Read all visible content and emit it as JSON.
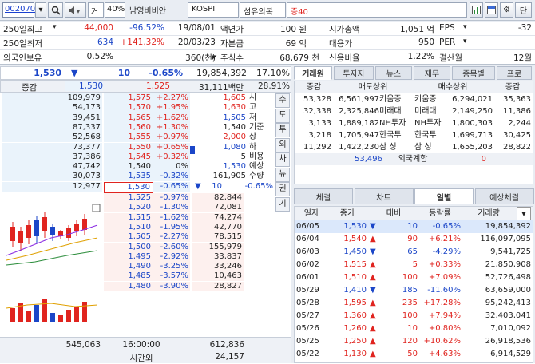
{
  "toolbar": {
    "code": "002070",
    "mode": "거",
    "ratio": "40%",
    "name": "남영비비안",
    "market": "KOSPI",
    "sector": "섬유의복",
    "margin": "증40",
    "btn_t": "단"
  },
  "info": {
    "r1": {
      "l1": "250일최고",
      "v1": "44,000",
      "v2": "-96.52%",
      "v3": "19/08/01",
      "l2": "액면가",
      "v4": "100 원",
      "l3": "시가총액",
      "v5": "1,051 억",
      "l4": "EPS",
      "v6": "-32"
    },
    "r2": {
      "l1": "250일최저",
      "v1": "634",
      "v2": "+141.32%",
      "v3": "20/03/23",
      "l2": "자본금",
      "v4": "69 억",
      "l3": "대용가",
      "v5": "950",
      "l4": "PER",
      "v6": ""
    },
    "r3": {
      "l1": "외국인보유",
      "v1": "0.52%",
      "v3": "360(천)",
      "l2": "주식수",
      "v4": "68,679 천",
      "l3": "신용비율",
      "v5": "1.22%",
      "l4": "결산월",
      "v6": "12월"
    }
  },
  "quote": {
    "price": "1,530",
    "arrow": "▼",
    "diff": "10",
    "rate": "-0.65%",
    "volume": "19,854,392",
    "turnover": "17.10%"
  },
  "quote2": {
    "label": "증감",
    "v1": "1,530",
    "v2": "1,525",
    "amount": "31,111백만",
    "pct": "28.91%"
  },
  "asks": [
    {
      "q": "109,979",
      "p": "1,575",
      "r": "+2.27%"
    },
    {
      "q": "54,173",
      "p": "1,570",
      "r": "+1.95%"
    },
    {
      "q": "39,451",
      "p": "1,565",
      "r": "+1.62%"
    },
    {
      "q": "87,337",
      "p": "1,560",
      "r": "+1.30%"
    },
    {
      "q": "52,568",
      "p": "1,555",
      "r": "+0.97%"
    },
    {
      "q": "73,377",
      "p": "1,550",
      "r": "+0.65%"
    },
    {
      "q": "37,386",
      "p": "1,545",
      "r": "+0.32%"
    },
    {
      "q": "47,742",
      "p": "1,540",
      "r": "0%"
    },
    {
      "q": "30,073",
      "p": "1,535",
      "r": "-0.32%"
    },
    {
      "q": "12,977",
      "p": "1,530",
      "r": "-0.65%"
    }
  ],
  "bids": [
    {
      "p": "1,525",
      "r": "-0.97%",
      "q": "82,844"
    },
    {
      "p": "1,520",
      "r": "-1.30%",
      "q": "72,081"
    },
    {
      "p": "1,515",
      "r": "-1.62%",
      "q": "74,274"
    },
    {
      "p": "1,510",
      "r": "-1.95%",
      "q": "42,770"
    },
    {
      "p": "1,505",
      "r": "-2.27%",
      "q": "78,515"
    },
    {
      "p": "1,500",
      "r": "-2.60%",
      "q": "155,979"
    },
    {
      "p": "1,495",
      "r": "-2.92%",
      "q": "33,837"
    },
    {
      "p": "1,490",
      "r": "-3.25%",
      "q": "33,246"
    },
    {
      "p": "1,485",
      "r": "-3.57%",
      "q": "10,463"
    },
    {
      "p": "1,480",
      "r": "-3.90%",
      "q": "28,827"
    }
  ],
  "summary": [
    {
      "v": "1,605",
      "l": "시"
    },
    {
      "v": "1,630",
      "l": "고"
    },
    {
      "v": "1,505",
      "l": "저"
    },
    {
      "v": "1,540",
      "l": "기준"
    },
    {
      "v": "2,000",
      "l": "상"
    },
    {
      "v": "1,080",
      "l": "하"
    },
    {
      "v": "5",
      "l": "비용"
    },
    {
      "v": "1,530",
      "l": "예상"
    },
    {
      "v": "161,905",
      "l": "수량"
    },
    {
      "v": "10",
      "l": "-0.65%",
      "a": "▼"
    }
  ],
  "side_tabs": [
    "수",
    "도",
    "투",
    "외",
    "차",
    "뉴",
    "권",
    "기"
  ],
  "book_footer": {
    "ask_total": "545,063",
    "time": "16:00:00",
    "bid_total": "612,836",
    "after_label": "시간외",
    "after_qty": "24,157"
  },
  "brk_tabs": [
    "거래원",
    "투자자",
    "뉴스",
    "재무",
    "종목별",
    "프로"
  ],
  "brk_header": {
    "c1": "증감",
    "c2": "매도상위",
    "c3": "매수상위",
    "c4": "증감"
  },
  "brokers": [
    {
      "d1": "53,328",
      "s": "6,561,997",
      "sn": "키움증",
      "bn": "키움증",
      "b": "6,294,021",
      "d2": "35,363"
    },
    {
      "d1": "32,338",
      "s": "2,325,846",
      "sn": "미래대",
      "bn": "미래대",
      "b": "2,149,250",
      "d2": "11,386"
    },
    {
      "d1": "3,133",
      "s": "1,889,182",
      "sn": "NH투자",
      "bn": "NH투자",
      "b": "1,800,303",
      "d2": "2,244"
    },
    {
      "d1": "3,218",
      "s": "1,705,947",
      "sn": "한국투",
      "bn": "한국투",
      "b": "1,699,713",
      "d2": "30,425"
    },
    {
      "d1": "11,292",
      "s": "1,422,230",
      "sn": "삼 성",
      "bn": "삼 성",
      "b": "1,655,203",
      "d2": "28,822"
    }
  ],
  "foreign": {
    "val": "53,496",
    "label": "외국계합",
    "val2": "0"
  },
  "bottom_tabs": [
    "체결",
    "차트",
    "일별",
    "예상체결"
  ],
  "daily_header": {
    "date": "일자",
    "close": "종가",
    "diff": "대비",
    "rate": "등락률",
    "vol": "거래량"
  },
  "daily": [
    {
      "d": "06/05",
      "c": "1,530",
      "a": "▼",
      "df": "10",
      "r": "-0.65%",
      "v": "19,854,392"
    },
    {
      "d": "06/04",
      "c": "1,540",
      "a": "▲",
      "df": "90",
      "r": "+6.21%",
      "v": "116,097,095"
    },
    {
      "d": "06/03",
      "c": "1,450",
      "a": "▼",
      "df": "65",
      "r": "-4.29%",
      "v": "9,541,725"
    },
    {
      "d": "06/02",
      "c": "1,515",
      "a": "▲",
      "df": "5",
      "r": "+0.33%",
      "v": "21,850,908"
    },
    {
      "d": "06/01",
      "c": "1,510",
      "a": "▲",
      "df": "100",
      "r": "+7.09%",
      "v": "52,726,498"
    },
    {
      "d": "05/29",
      "c": "1,410",
      "a": "▼",
      "df": "185",
      "r": "-11.60%",
      "v": "63,659,000"
    },
    {
      "d": "05/28",
      "c": "1,595",
      "a": "▲",
      "df": "235",
      "r": "+17.28%",
      "v": "95,242,413"
    },
    {
      "d": "05/27",
      "c": "1,360",
      "a": "▲",
      "df": "100",
      "r": "+7.94%",
      "v": "32,403,041"
    },
    {
      "d": "05/26",
      "c": "1,260",
      "a": "▲",
      "df": "10",
      "r": "+0.80%",
      "v": "7,010,092"
    },
    {
      "d": "05/25",
      "c": "1,250",
      "a": "▲",
      "df": "120",
      "r": "+10.62%",
      "v": "26,918,536"
    },
    {
      "d": "05/22",
      "c": "1,130",
      "a": "▲",
      "df": "50",
      "r": "+4.63%",
      "v": "6,914,529"
    }
  ]
}
